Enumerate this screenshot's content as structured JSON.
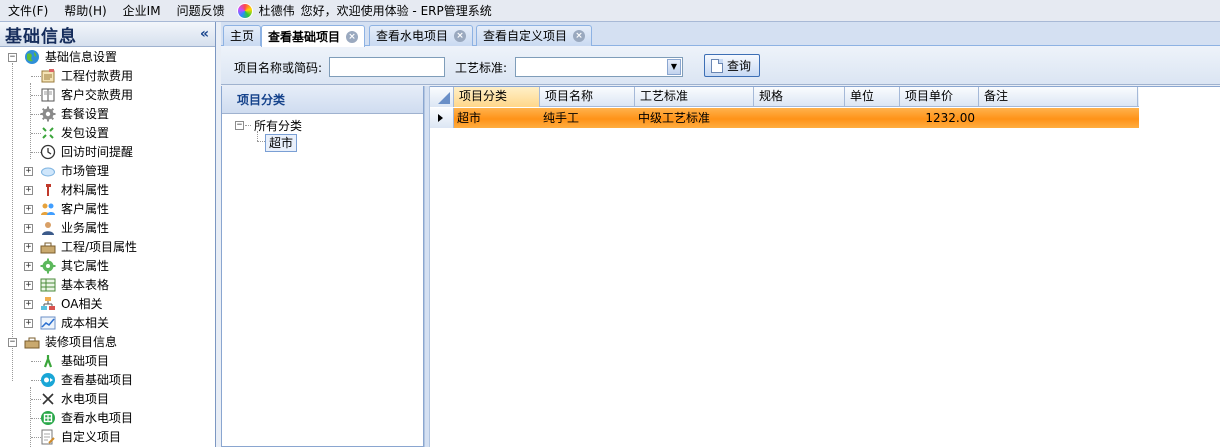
{
  "menubar": {
    "items": [
      "文件(F)",
      "帮助(H)",
      "企业IM",
      "问题反馈"
    ],
    "user_name": "杜德伟",
    "welcome": "您好，欢迎使用体验 - ERP管理系统"
  },
  "left_panel": {
    "title": "基础信息",
    "collapse_glyph": "«",
    "tree": {
      "group1": {
        "label": "基础信息设置",
        "children": [
          "工程付款费用",
          "客户交款费用",
          "套餐设置",
          "发包设置",
          "回访时间提醒"
        ],
        "subgroups": [
          "市场管理",
          "材料属性",
          "客户属性",
          "业务属性",
          "工程/项目属性",
          "其它属性",
          "基本表格",
          "OA相关",
          "成本相关"
        ]
      },
      "group2": {
        "label": "装修项目信息",
        "children": [
          "基础项目",
          "查看基础项目",
          "水电项目",
          "查看水电项目",
          "自定义项目"
        ]
      }
    }
  },
  "tabs": {
    "home": "主页",
    "items": [
      "查看基础项目",
      "查看水电项目",
      "查看自定义项目"
    ],
    "active_index": 0,
    "close_glyph": "×"
  },
  "search": {
    "name_label": "项目名称或简码:",
    "name_value": "",
    "standard_label": "工艺标准:",
    "standard_value": "",
    "query_label": "查询"
  },
  "category_panel": {
    "title": "项目分类",
    "root": "所有分类",
    "child": "超市"
  },
  "grid": {
    "columns": [
      "项目分类",
      "项目名称",
      "工艺标准",
      "规格",
      "单位",
      "项目单价",
      "备注"
    ],
    "rows": [
      [
        "超市",
        "纯手工",
        "中级工艺标准",
        "",
        "",
        "1232.00",
        ""
      ]
    ]
  },
  "colors": {
    "selected_row": "#ff9a2a",
    "header_blue": "#15428b"
  }
}
